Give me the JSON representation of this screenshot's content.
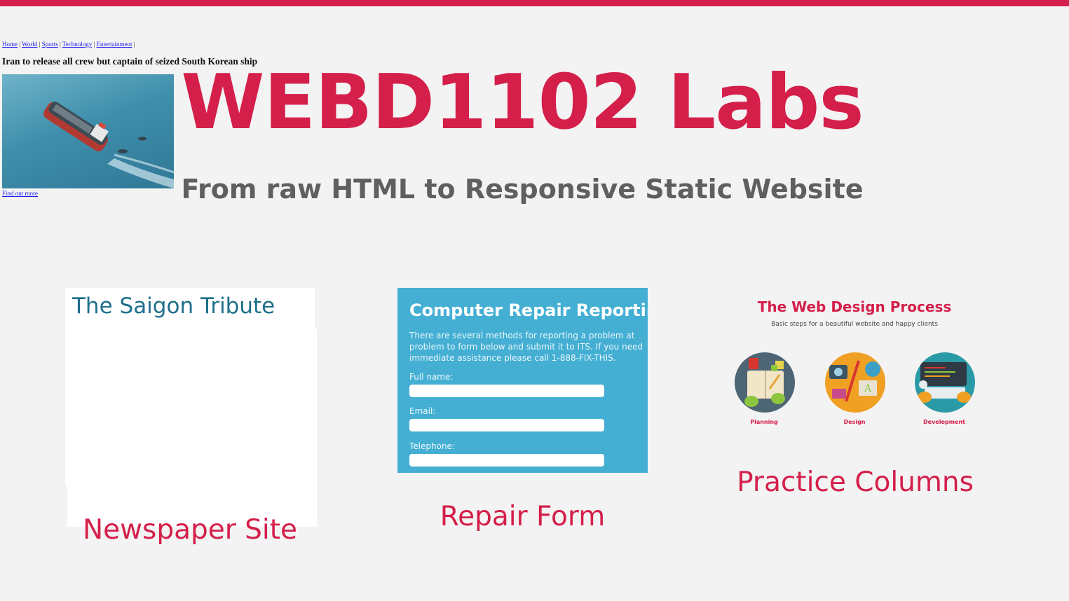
{
  "page": {
    "title": "WEBD1102 Labs",
    "subtitle": "From raw HTML to Responsive Static Website",
    "accent_color": "#d41f4a"
  },
  "cards": [
    {
      "label": "Newspaper Site",
      "thumbnail": {
        "masthead": "The Saigon Tribute",
        "nav": [
          "Home",
          "World",
          "Sports",
          "Technology",
          "Entertainment"
        ],
        "headline": "Iran to release all crew but captain of seized South Korean ship",
        "link": "Find out more"
      }
    },
    {
      "label": "Repair Form",
      "thumbnail": {
        "title": "Computer Repair Reporting",
        "description": "There are several methods for reporting a problem at problem to form below and submit it to ITS. If you need immediate assistance please call 1-888-FIX-THIS.",
        "fields": [
          "Full name:",
          "Email:",
          "Telephone:"
        ]
      }
    },
    {
      "label": "Practice Columns",
      "thumbnail": {
        "title": "The Web Design Process",
        "subtitle": "Basic steps for a beautiful website and happy clients",
        "steps": [
          "Planning",
          "Design",
          "Development"
        ]
      }
    }
  ]
}
